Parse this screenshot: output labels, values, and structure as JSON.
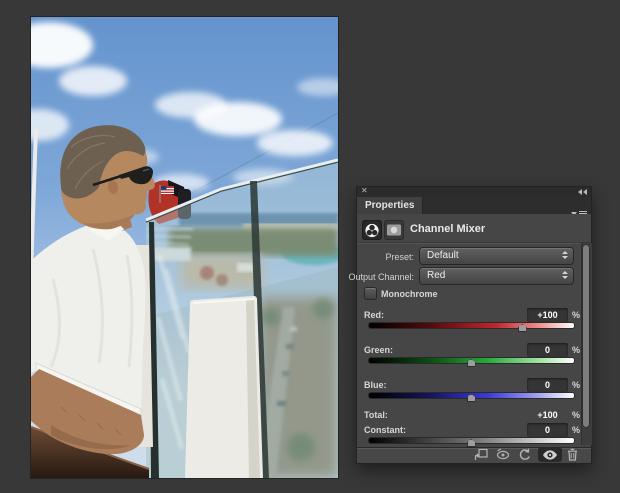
{
  "window": {
    "background": "#383838"
  },
  "photo": {
    "description": "Man in a white shirt leaning on a wooden rail beside a red ship funnel, looking through the glass railing of a cruise-ship deck at a tropical shoreline with turquoise water, under a blue sky with clouds"
  },
  "panel": {
    "titlebar": {
      "close": "✕",
      "collapse_icon": "collapse-double-arrow"
    },
    "tab": {
      "label": "Properties"
    },
    "header": {
      "title": "Channel Mixer",
      "icons": [
        "channel-mixer-adjustment-icon",
        "layer-mask-icon"
      ]
    },
    "preset": {
      "label": "Preset:",
      "value": "Default"
    },
    "output_channel": {
      "label": "Output Channel:",
      "value": "Red"
    },
    "monochrome": {
      "label": "Monochrome",
      "checked": false
    },
    "channels": {
      "red": {
        "label": "Red:",
        "value": "+100",
        "unit": "%",
        "thumb_left": "75%"
      },
      "green": {
        "label": "Green:",
        "value": "0",
        "unit": "%",
        "thumb_left": "50%"
      },
      "blue": {
        "label": "Blue:",
        "value": "0",
        "unit": "%",
        "thumb_left": "50%"
      }
    },
    "total": {
      "label": "Total:",
      "value": "+100",
      "unit": "%"
    },
    "constant": {
      "label": "Constant:",
      "value": "0",
      "unit": "%",
      "thumb_left": "50%"
    },
    "footer": {
      "icons": [
        "clip-to-layer",
        "view-previous-state",
        "reset",
        "toggle-visibility",
        "delete"
      ]
    },
    "colors": {
      "panel_bg": "#464646",
      "red_accent": "#c2272e",
      "green_accent": "#2aa93a",
      "blue_accent": "#3a3ad6",
      "value_text": "#ffffff"
    }
  }
}
